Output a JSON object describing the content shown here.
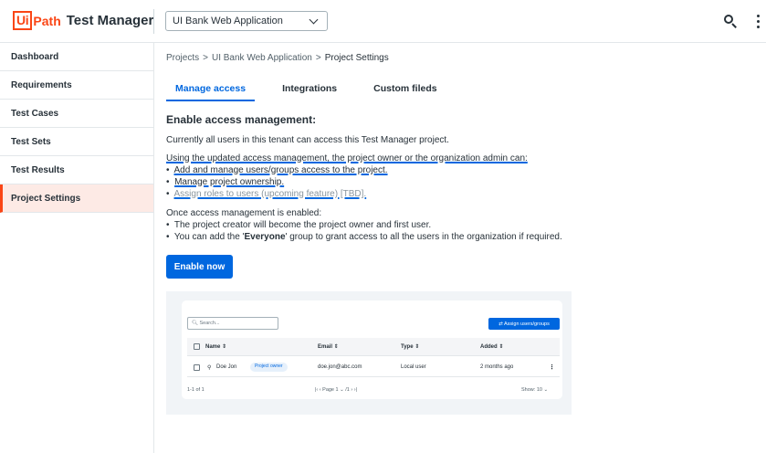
{
  "header": {
    "logo_box": "Ui",
    "logo_path": "Path",
    "app_name": "Test Manager",
    "project_selector": "UI Bank Web Application",
    "search_icon": "search-icon",
    "more_icon": "more-vertical-icon"
  },
  "sidebar": {
    "items": [
      {
        "label": "Dashboard"
      },
      {
        "label": "Requirements"
      },
      {
        "label": "Test Cases"
      },
      {
        "label": "Test Sets"
      },
      {
        "label": "Test Results"
      },
      {
        "label": "Project Settings",
        "active": true
      }
    ]
  },
  "breadcrumb": {
    "items": [
      "Projects",
      "UI Bank Web Application",
      "Project Settings"
    ],
    "separator": ">"
  },
  "tabs": [
    {
      "label": "Manage access",
      "active": true
    },
    {
      "label": "Integrations"
    },
    {
      "label": "Custom fileds"
    }
  ],
  "content": {
    "heading": "Enable access management:",
    "intro": "Currently all users in this tenant can access this Test Manager project.",
    "updated_title": "Using the updated access management, the project owner or the organization admin can:",
    "bullets": [
      "Add and manage users/groups access to the project.",
      "Manage project ownership.",
      "Assign roles to users (upcoming feature) [TBD]."
    ],
    "once_title": "Once access management is enabled:",
    "once_bullets": [
      "The project creator will become the project owner and first user.",
      "You can add the 'Everyone' group to grant access to all the users in the organization if required."
    ],
    "everyone_word": "Everyone",
    "enable_button": "Enable now"
  },
  "preview": {
    "search_placeholder": "Search...",
    "assign_button": "⇄ Assign users/groups",
    "columns": [
      "Name ⇕",
      "Email ⇕",
      "Type ⇕",
      "Added ⇕"
    ],
    "row": {
      "name": "Doe Jon",
      "badge": "Project owner",
      "email": "doe.jon@abc.com",
      "type": "Local user",
      "added": "2 months ago"
    },
    "footer": {
      "range": "1-1 of 1",
      "pager": "|‹   ‹   Page   1 ⌄  /1      ›   ›|",
      "show": "Show: 10 ⌄"
    }
  },
  "colors": {
    "brand": "#fa4616",
    "accent": "#0067df",
    "active_bg": "#fdeae5"
  }
}
